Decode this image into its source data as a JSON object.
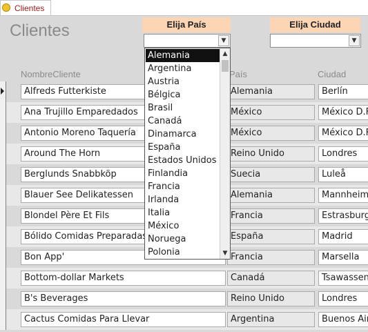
{
  "tab": {
    "label": "Clientes",
    "icon": "form-icon"
  },
  "header": {
    "title": "Clientes",
    "pais_filter": {
      "label": "Elija País",
      "value": ""
    },
    "ciudad_filter": {
      "label": "Elija Ciudad",
      "value": ""
    }
  },
  "columns": {
    "nombre": "NombreCliente",
    "pais": "País",
    "ciudad": "Ciudad"
  },
  "rows": [
    {
      "nombre": "Alfreds Futterkiste",
      "pais": "Alemania",
      "ciudad": "Berlín"
    },
    {
      "nombre": "Ana Trujillo Emparedados",
      "pais": "México",
      "ciudad": "México D.F."
    },
    {
      "nombre": "Antonio Moreno Taquería",
      "pais": "México",
      "ciudad": "México D.F."
    },
    {
      "nombre": "Around The Horn",
      "pais": "Reino Unido",
      "ciudad": "Londres"
    },
    {
      "nombre": "Berglunds Snabbköp",
      "pais": "Suecia",
      "ciudad": "Luleå"
    },
    {
      "nombre": "Blauer See Delikatessen",
      "pais": "Alemania",
      "ciudad": "Mannheim"
    },
    {
      "nombre": "Blondel Père Et Fils",
      "pais": "Francia",
      "ciudad": "Estrasburgo"
    },
    {
      "nombre": "Bólido Comidas Preparadas",
      "pais": "España",
      "ciudad": "Madrid"
    },
    {
      "nombre": "Bon App'",
      "pais": "Francia",
      "ciudad": "Marsella"
    },
    {
      "nombre": "Bottom-dollar Markets",
      "pais": "Canadá",
      "ciudad": "Tsawassen"
    },
    {
      "nombre": "B's Beverages",
      "pais": "Reino Unido",
      "ciudad": "Londres"
    },
    {
      "nombre": "Cactus Comidas Para Llevar",
      "pais": "Argentina",
      "ciudad": "Buenos Aires"
    }
  ],
  "dropdown": {
    "selected": "Alemania",
    "options": [
      "Alemania",
      "Argentina",
      "Austria",
      "Bélgica",
      "Brasil",
      "Canadá",
      "Dinamarca",
      "España",
      "Estados Unidos",
      "Finlandia",
      "Francia",
      "Irlanda",
      "Italia",
      "México",
      "Noruega",
      "Polonia"
    ]
  }
}
